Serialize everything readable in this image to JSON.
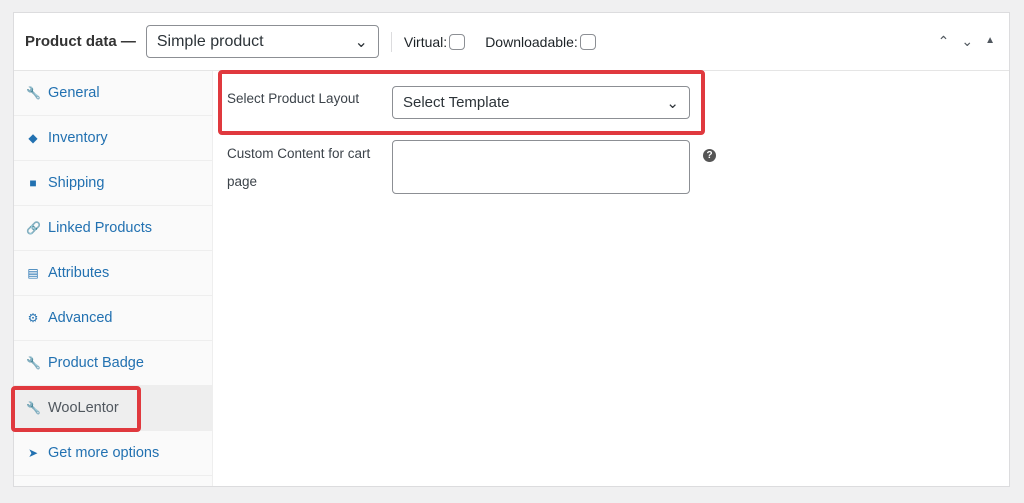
{
  "header": {
    "title": "Product data —",
    "product_type": "Simple product",
    "virtual_label": "Virtual:",
    "downloadable_label": "Downloadable:"
  },
  "sidebar": {
    "items": [
      {
        "label": "General",
        "icon": "wrench-icon"
      },
      {
        "label": "Inventory",
        "icon": "tag-icon"
      },
      {
        "label": "Shipping",
        "icon": "truck-icon"
      },
      {
        "label": "Linked Products",
        "icon": "link-icon"
      },
      {
        "label": "Attributes",
        "icon": "list-icon"
      },
      {
        "label": "Advanced",
        "icon": "gear-icon"
      },
      {
        "label": "Product Badge",
        "icon": "wrench-icon"
      },
      {
        "label": "WooLentor",
        "icon": "wrench-icon"
      },
      {
        "label": "Get more options",
        "icon": "plugin-icon"
      }
    ]
  },
  "main": {
    "layout_label": "Select Product Layout",
    "layout_value": "Select Template",
    "cart_label": "Custom Content for cart page",
    "cart_value": ""
  },
  "colors": {
    "highlight": "#e0393e",
    "link": "#2271b1"
  }
}
